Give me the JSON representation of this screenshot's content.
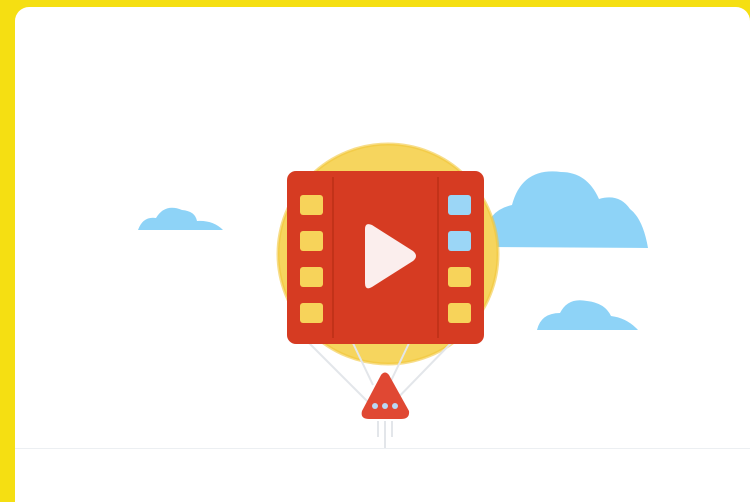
{
  "illustration": {
    "subject": "video-play",
    "colors": {
      "background_frame": "#f5df12",
      "card": "#ffffff",
      "sun": "#f6d55e",
      "sun_outline": "#f1c63a",
      "film": "#d63b22",
      "film_holes": "#f7d35a",
      "film_holes_right_top": "#9bd6f6",
      "play": "#fbeeed",
      "cloud": "#8ed3f7",
      "rocket": "#e04833",
      "rocket_dots": "#b8d8f4",
      "strings": "#e3e6ea"
    },
    "icons": [
      "film-strip-icon",
      "play-icon",
      "sun-icon",
      "cloud-icon",
      "rocket-icon"
    ]
  }
}
